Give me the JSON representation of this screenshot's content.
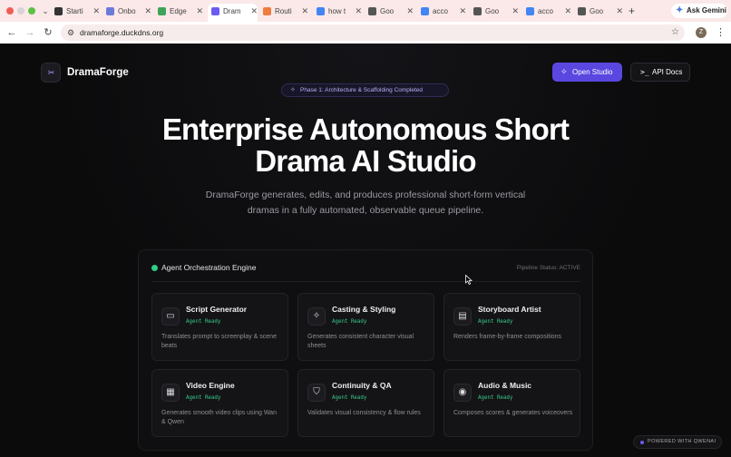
{
  "browser": {
    "tabs": [
      {
        "title": "Starti",
        "favicon_color": "#333333"
      },
      {
        "title": "Onbo",
        "favicon_color": "#6a7ad8"
      },
      {
        "title": "Edge",
        "favicon_color": "#3fa45b"
      },
      {
        "title": "Dram",
        "favicon_color": "#6b5cf0",
        "active": true
      },
      {
        "title": "Routi",
        "favicon_color": "#f07b3f"
      },
      {
        "title": "how t",
        "favicon_color": "#4285f4"
      },
      {
        "title": "Goo",
        "favicon_color": "#555555"
      },
      {
        "title": "acco",
        "favicon_color": "#4285f4"
      },
      {
        "title": "Goo",
        "favicon_color": "#555555"
      },
      {
        "title": "acco",
        "favicon_color": "#4285f4"
      },
      {
        "title": "Goo",
        "favicon_color": "#555555"
      }
    ],
    "new_tab_glyph": "+",
    "ask_gemini": "Ask Gemini",
    "url": "dramaforge.duckdns.org",
    "profile_initial": "Z"
  },
  "header": {
    "brand": "DramaForge",
    "open_studio": "Open Studio",
    "api_docs": "API Docs"
  },
  "hero": {
    "badge": "Phase 1: Architecture & Scaffolding Completed",
    "title_line1": "Enterprise Autonomous Short",
    "title_line2": "Drama AI Studio",
    "subtitle_line1": "DramaForge generates, edits, and produces professional short-form vertical",
    "subtitle_line2": "dramas in a fully automated, observable queue pipeline."
  },
  "panel": {
    "title": "Agent Orchestration Engine",
    "status": "Pipeline Status: ACTIVE",
    "status_color": "#2fce8a",
    "agents": [
      {
        "name": "Script Generator",
        "status": "Agent Ready",
        "desc": "Translates prompt to screenplay & scene beats",
        "icon": "message-square-icon"
      },
      {
        "name": "Casting & Styling",
        "status": "Agent Ready",
        "desc": "Generates consistent character visual sheets",
        "icon": "sparkles-icon"
      },
      {
        "name": "Storyboard Artist",
        "status": "Agent Ready",
        "desc": "Renders frame-by-frame compositions",
        "icon": "layout-icon"
      },
      {
        "name": "Video Engine",
        "status": "Agent Ready",
        "desc": "Generates smooth video clips using Wan & Qwen",
        "icon": "film-icon"
      },
      {
        "name": "Continuity & QA",
        "status": "Agent Ready",
        "desc": "Validates visual consistency & flow rules",
        "icon": "shield-check-icon"
      },
      {
        "name": "Audio & Music",
        "status": "Agent Ready",
        "desc": "Composes scores & generates voiceovers",
        "icon": "radio-icon"
      }
    ]
  },
  "footer_badge": "POWERED WITH QWENAI"
}
